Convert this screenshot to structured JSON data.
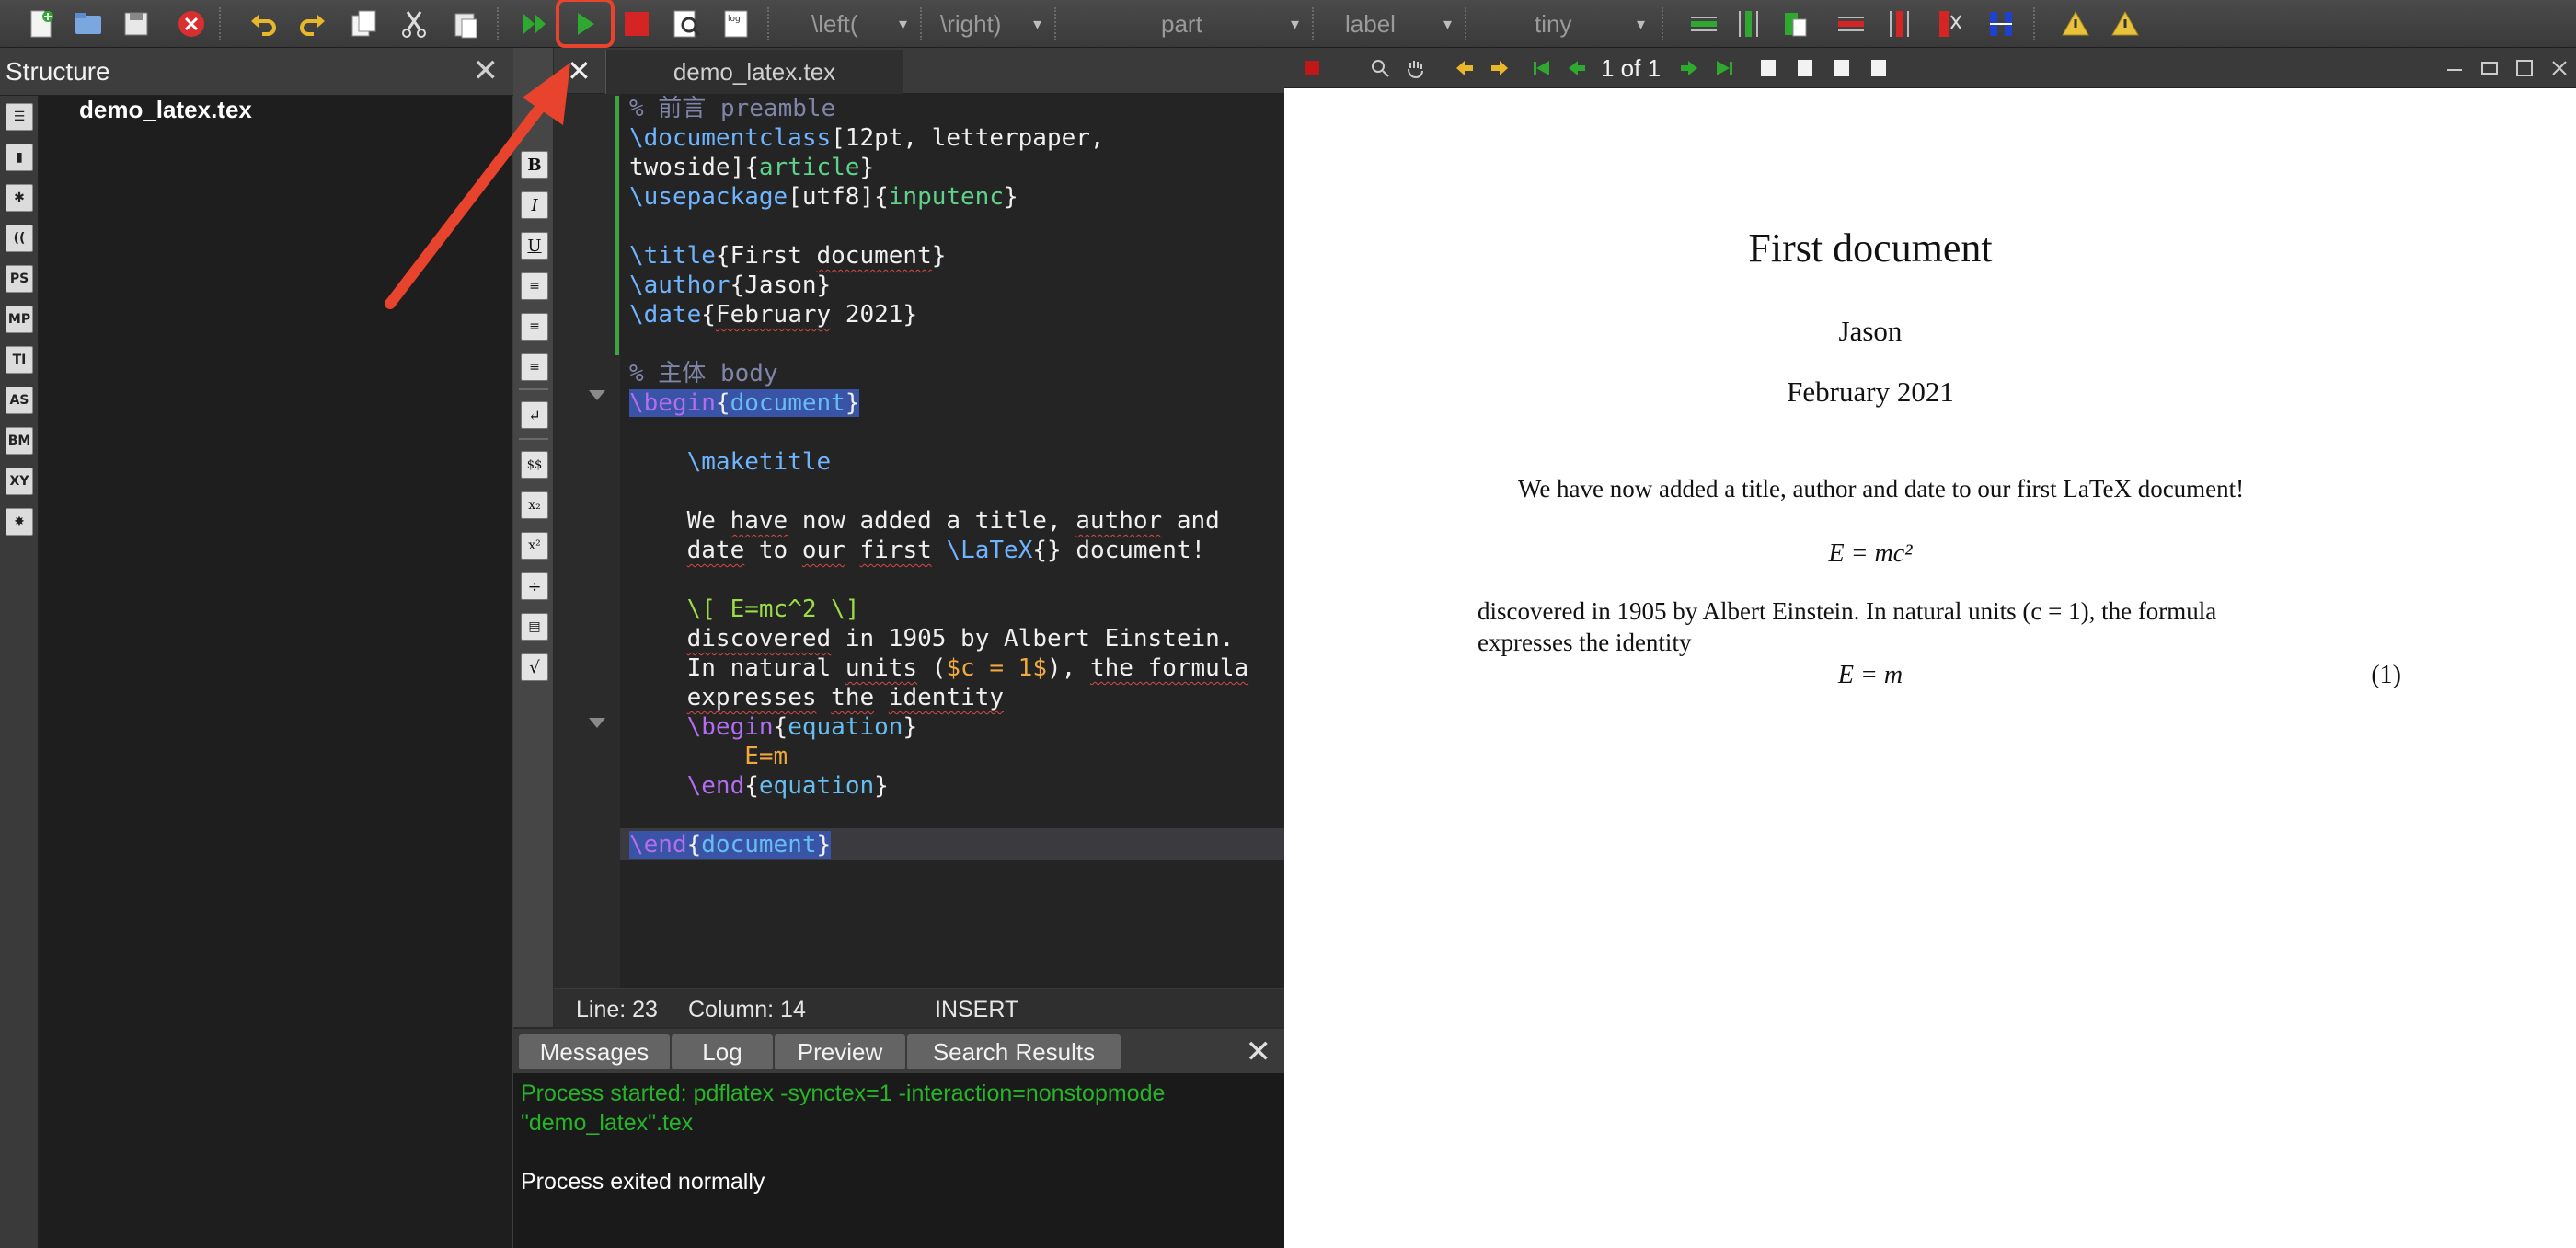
{
  "toolbar": {
    "combos": {
      "left": "\\left(",
      "right": "\\right)",
      "sectioning": "part",
      "references": "label",
      "size": "tiny"
    }
  },
  "structure": {
    "title": "Structure",
    "close": "✕",
    "file": "demo_latex.tex"
  },
  "editor": {
    "tab_close": "✕",
    "tab_label": "demo_latex.tex"
  },
  "strip_icons": [
    "B",
    "I",
    "U",
    "$$",
    "÷",
    "√"
  ],
  "left_strip_icons": [
    "PS",
    "MP",
    "TI",
    "AS",
    "BM",
    "XY"
  ],
  "status": {
    "line": "Line: 23",
    "column": "Column: 14",
    "mode": "INSERT"
  },
  "messages": {
    "tabs": [
      "Messages",
      "Log",
      "Preview",
      "Search Results"
    ],
    "close": "✕",
    "process_started": "Process started: pdflatex -synctex=1 -interaction=nonstopmode",
    "process_started_cont": "\"demo_latex\".tex",
    "process_exited": "Process exited normally"
  },
  "viewer": {
    "page_indicator": "1 of 1"
  },
  "document": {
    "title": "First document",
    "author": "Jason",
    "date": "February 2021",
    "para1": "We have now added a title, author and date to our first LaTeX document!",
    "eq1": "E = mc²",
    "para2_line1": "discovered in 1905 by Albert Einstein. In natural units (c = 1), the formula",
    "para2_line2": "expresses the identity",
    "eq2": "E = m",
    "eq2_number": "(1)"
  },
  "colors": {
    "highlight_red": "#e8432d",
    "run_green": "#2fa82f",
    "stop_red": "#d42424"
  }
}
